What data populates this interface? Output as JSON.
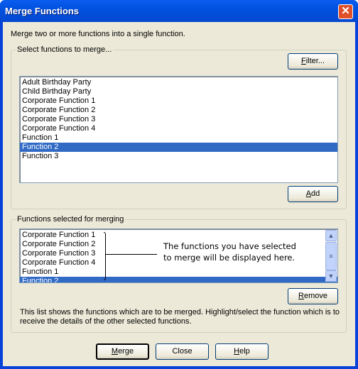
{
  "window": {
    "title": "Merge Functions",
    "close_glyph": "✕"
  },
  "intro": "Merge two or more functions into a single function.",
  "select_group": {
    "label": "Select functions to merge...",
    "filter_label": "Filter...",
    "filter_key": "F",
    "filter_rest": "ilter...",
    "add_key": "A",
    "add_rest": "dd",
    "items": [
      "Adult Birthday Party",
      "Child Birthday Party",
      "Corporate Function 1",
      "Corporate Function 2",
      "Corporate Function 3",
      "Corporate Function 4",
      "Function 1",
      "Function 2",
      "Function 3"
    ],
    "selected_index": 7
  },
  "merge_group": {
    "label": "Functions selected for merging",
    "items": [
      "Corporate Function 1",
      "Corporate Function 2",
      "Corporate Function 3",
      "Corporate Function 4",
      "Function 1",
      "Function 2"
    ],
    "selected_index": 5,
    "callout_line1": "The functions you have selected",
    "callout_line2": "to merge will be displayed here.",
    "remove_key": "R",
    "remove_rest": "emove",
    "help_line1": "This list shows the functions which are to be merged.  Highlight/select the function which is to",
    "help_line2": "receive the details of the other selected functions."
  },
  "buttons": {
    "merge_key": "M",
    "merge_rest": "erge",
    "close": "Close",
    "help_key": "H",
    "help_rest": "elp"
  },
  "colors": {
    "selection": "#316ac5",
    "dialog": "#ECE9D8",
    "titlebar": "#0251e0"
  }
}
